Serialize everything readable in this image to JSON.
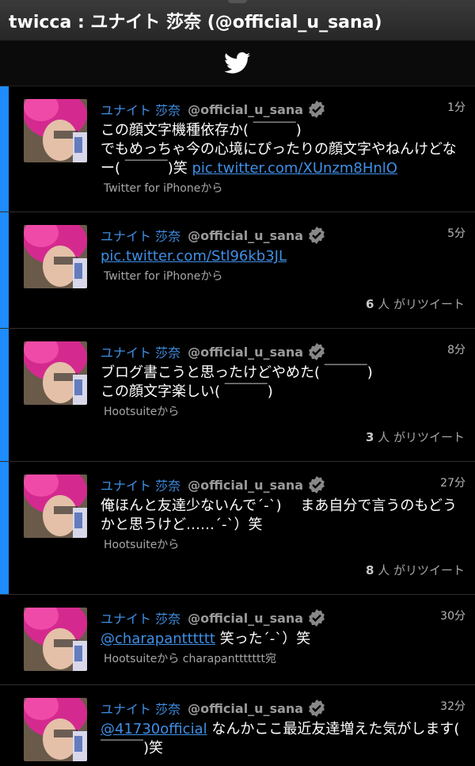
{
  "app": {
    "title": "twicca : ユナイト 莎奈 (@official_u_sana)"
  },
  "header": {
    "logo_icon": "twitter-bird-icon"
  },
  "colors": {
    "accent": "#1e8cff",
    "link": "#3f8fe5",
    "background": "#000000"
  },
  "tweets": [
    {
      "name": "ユナイト 莎奈",
      "screen": "@official_u_sana",
      "time": "1分",
      "text": "この顔文字機種依存か( ￣￣￣)\nでもめっちゃ今の心境にぴったりの顔文字やねんけどなー( ￣￣￣)笑 ",
      "link": "pic.twitter.com/XUnzm8HnlO",
      "via": "Twitter for iPhoneから",
      "rt_count": "",
      "rt_label": ""
    },
    {
      "name": "ユナイト 莎奈",
      "screen": "@official_u_sana",
      "time": "5分",
      "text": "",
      "link": "pic.twitter.com/Stl96kb3JL",
      "via": "Twitter for iPhoneから",
      "rt_count": "6",
      "rt_label": " 人 がリツイート"
    },
    {
      "name": "ユナイト 莎奈",
      "screen": "@official_u_sana",
      "time": "8分",
      "text": "ブログ書こうと思ったけどやめた( ￣￣￣)\nこの顔文字楽しい( ￣￣￣)",
      "link": "",
      "via": "Hootsuiteから",
      "rt_count": "3",
      "rt_label": " 人 がリツイート"
    },
    {
      "name": "ユナイト 莎奈",
      "screen": "@official_u_sana",
      "time": "27分",
      "text": "俺ほんと友達少ないんで´-`)　 まあ自分で言うのもどうかと思うけど……´-`）笑",
      "link": "",
      "via": "Hootsuiteから",
      "rt_count": "8",
      "rt_label": " 人 がリツイート"
    },
    {
      "name": "ユナイト 莎奈",
      "screen": "@official_u_sana",
      "time": "30分",
      "text_prefix_link": "@charapantttttt",
      "text": " 笑った´-`）笑",
      "via": "Hootsuiteから charapanttttttt宛",
      "rt_count": "",
      "rt_label": ""
    },
    {
      "name": "ユナイト 莎奈",
      "screen": "@official_u_sana",
      "time": "32分",
      "text_prefix_link": "@41730official",
      "text": " なんかここ最近友達増えた気がします( ￣￣￣)笑",
      "via": "",
      "rt_count": "",
      "rt_label": ""
    }
  ]
}
